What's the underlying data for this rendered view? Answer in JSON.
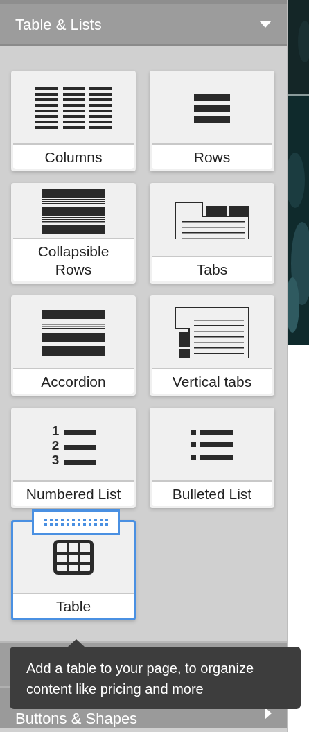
{
  "section": {
    "title": "Table & Lists",
    "expanded": true
  },
  "tiles": [
    {
      "label": "Columns",
      "kind": "columns",
      "selected": false
    },
    {
      "label": "Rows",
      "kind": "rows",
      "selected": false
    },
    {
      "label": "Collapsible Rows",
      "kind": "collapsible",
      "selected": false
    },
    {
      "label": "Tabs",
      "kind": "tabs",
      "selected": false
    },
    {
      "label": "Accordion",
      "kind": "accordion",
      "selected": false
    },
    {
      "label": "Vertical tabs",
      "kind": "vtabs",
      "selected": false
    },
    {
      "label": "Numbered List",
      "kind": "numbered",
      "selected": false,
      "markers": [
        "1",
        "2",
        "3"
      ]
    },
    {
      "label": "Bulleted List",
      "kind": "bulleted",
      "selected": false
    },
    {
      "label": "Table",
      "kind": "table",
      "selected": true
    }
  ],
  "tooltip": {
    "text": "Add a table to your page, to organize content like pricing and more"
  },
  "next_section": {
    "title": "Buttons & Shapes",
    "expanded": false
  }
}
